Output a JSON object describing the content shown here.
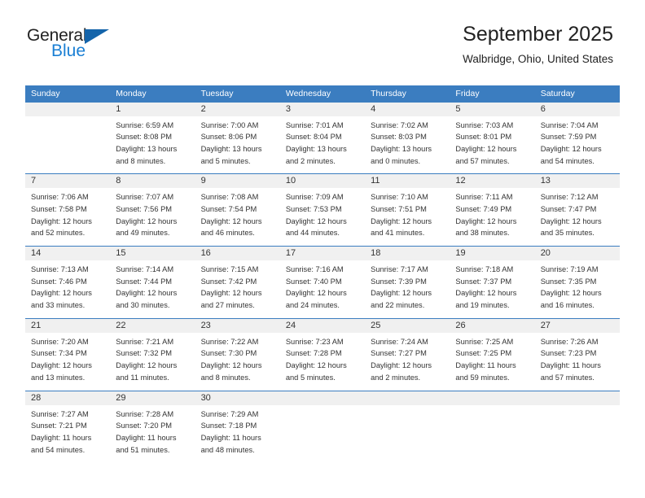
{
  "brand": {
    "name_top": "General",
    "name_bottom": "Blue",
    "accent_color": "#1a7fd4",
    "triangle_color": "#1464aa"
  },
  "header": {
    "title": "September 2025",
    "subtitle": "Walbridge, Ohio, United States"
  },
  "calendar": {
    "header_bg": "#3b7dc0",
    "daynum_bg": "#f0f0f0",
    "weekday_headers": [
      "Sunday",
      "Monday",
      "Tuesday",
      "Wednesday",
      "Thursday",
      "Friday",
      "Saturday"
    ],
    "weeks": [
      [
        {
          "day": "",
          "sunrise": "",
          "sunset": "",
          "daylight_1": "",
          "daylight_2": ""
        },
        {
          "day": "1",
          "sunrise": "Sunrise: 6:59 AM",
          "sunset": "Sunset: 8:08 PM",
          "daylight_1": "Daylight: 13 hours",
          "daylight_2": "and 8 minutes."
        },
        {
          "day": "2",
          "sunrise": "Sunrise: 7:00 AM",
          "sunset": "Sunset: 8:06 PM",
          "daylight_1": "Daylight: 13 hours",
          "daylight_2": "and 5 minutes."
        },
        {
          "day": "3",
          "sunrise": "Sunrise: 7:01 AM",
          "sunset": "Sunset: 8:04 PM",
          "daylight_1": "Daylight: 13 hours",
          "daylight_2": "and 2 minutes."
        },
        {
          "day": "4",
          "sunrise": "Sunrise: 7:02 AM",
          "sunset": "Sunset: 8:03 PM",
          "daylight_1": "Daylight: 13 hours",
          "daylight_2": "and 0 minutes."
        },
        {
          "day": "5",
          "sunrise": "Sunrise: 7:03 AM",
          "sunset": "Sunset: 8:01 PM",
          "daylight_1": "Daylight: 12 hours",
          "daylight_2": "and 57 minutes."
        },
        {
          "day": "6",
          "sunrise": "Sunrise: 7:04 AM",
          "sunset": "Sunset: 7:59 PM",
          "daylight_1": "Daylight: 12 hours",
          "daylight_2": "and 54 minutes."
        }
      ],
      [
        {
          "day": "7",
          "sunrise": "Sunrise: 7:06 AM",
          "sunset": "Sunset: 7:58 PM",
          "daylight_1": "Daylight: 12 hours",
          "daylight_2": "and 52 minutes."
        },
        {
          "day": "8",
          "sunrise": "Sunrise: 7:07 AM",
          "sunset": "Sunset: 7:56 PM",
          "daylight_1": "Daylight: 12 hours",
          "daylight_2": "and 49 minutes."
        },
        {
          "day": "9",
          "sunrise": "Sunrise: 7:08 AM",
          "sunset": "Sunset: 7:54 PM",
          "daylight_1": "Daylight: 12 hours",
          "daylight_2": "and 46 minutes."
        },
        {
          "day": "10",
          "sunrise": "Sunrise: 7:09 AM",
          "sunset": "Sunset: 7:53 PM",
          "daylight_1": "Daylight: 12 hours",
          "daylight_2": "and 44 minutes."
        },
        {
          "day": "11",
          "sunrise": "Sunrise: 7:10 AM",
          "sunset": "Sunset: 7:51 PM",
          "daylight_1": "Daylight: 12 hours",
          "daylight_2": "and 41 minutes."
        },
        {
          "day": "12",
          "sunrise": "Sunrise: 7:11 AM",
          "sunset": "Sunset: 7:49 PM",
          "daylight_1": "Daylight: 12 hours",
          "daylight_2": "and 38 minutes."
        },
        {
          "day": "13",
          "sunrise": "Sunrise: 7:12 AM",
          "sunset": "Sunset: 7:47 PM",
          "daylight_1": "Daylight: 12 hours",
          "daylight_2": "and 35 minutes."
        }
      ],
      [
        {
          "day": "14",
          "sunrise": "Sunrise: 7:13 AM",
          "sunset": "Sunset: 7:46 PM",
          "daylight_1": "Daylight: 12 hours",
          "daylight_2": "and 33 minutes."
        },
        {
          "day": "15",
          "sunrise": "Sunrise: 7:14 AM",
          "sunset": "Sunset: 7:44 PM",
          "daylight_1": "Daylight: 12 hours",
          "daylight_2": "and 30 minutes."
        },
        {
          "day": "16",
          "sunrise": "Sunrise: 7:15 AM",
          "sunset": "Sunset: 7:42 PM",
          "daylight_1": "Daylight: 12 hours",
          "daylight_2": "and 27 minutes."
        },
        {
          "day": "17",
          "sunrise": "Sunrise: 7:16 AM",
          "sunset": "Sunset: 7:40 PM",
          "daylight_1": "Daylight: 12 hours",
          "daylight_2": "and 24 minutes."
        },
        {
          "day": "18",
          "sunrise": "Sunrise: 7:17 AM",
          "sunset": "Sunset: 7:39 PM",
          "daylight_1": "Daylight: 12 hours",
          "daylight_2": "and 22 minutes."
        },
        {
          "day": "19",
          "sunrise": "Sunrise: 7:18 AM",
          "sunset": "Sunset: 7:37 PM",
          "daylight_1": "Daylight: 12 hours",
          "daylight_2": "and 19 minutes."
        },
        {
          "day": "20",
          "sunrise": "Sunrise: 7:19 AM",
          "sunset": "Sunset: 7:35 PM",
          "daylight_1": "Daylight: 12 hours",
          "daylight_2": "and 16 minutes."
        }
      ],
      [
        {
          "day": "21",
          "sunrise": "Sunrise: 7:20 AM",
          "sunset": "Sunset: 7:34 PM",
          "daylight_1": "Daylight: 12 hours",
          "daylight_2": "and 13 minutes."
        },
        {
          "day": "22",
          "sunrise": "Sunrise: 7:21 AM",
          "sunset": "Sunset: 7:32 PM",
          "daylight_1": "Daylight: 12 hours",
          "daylight_2": "and 11 minutes."
        },
        {
          "day": "23",
          "sunrise": "Sunrise: 7:22 AM",
          "sunset": "Sunset: 7:30 PM",
          "daylight_1": "Daylight: 12 hours",
          "daylight_2": "and 8 minutes."
        },
        {
          "day": "24",
          "sunrise": "Sunrise: 7:23 AM",
          "sunset": "Sunset: 7:28 PM",
          "daylight_1": "Daylight: 12 hours",
          "daylight_2": "and 5 minutes."
        },
        {
          "day": "25",
          "sunrise": "Sunrise: 7:24 AM",
          "sunset": "Sunset: 7:27 PM",
          "daylight_1": "Daylight: 12 hours",
          "daylight_2": "and 2 minutes."
        },
        {
          "day": "26",
          "sunrise": "Sunrise: 7:25 AM",
          "sunset": "Sunset: 7:25 PM",
          "daylight_1": "Daylight: 11 hours",
          "daylight_2": "and 59 minutes."
        },
        {
          "day": "27",
          "sunrise": "Sunrise: 7:26 AM",
          "sunset": "Sunset: 7:23 PM",
          "daylight_1": "Daylight: 11 hours",
          "daylight_2": "and 57 minutes."
        }
      ],
      [
        {
          "day": "28",
          "sunrise": "Sunrise: 7:27 AM",
          "sunset": "Sunset: 7:21 PM",
          "daylight_1": "Daylight: 11 hours",
          "daylight_2": "and 54 minutes."
        },
        {
          "day": "29",
          "sunrise": "Sunrise: 7:28 AM",
          "sunset": "Sunset: 7:20 PM",
          "daylight_1": "Daylight: 11 hours",
          "daylight_2": "and 51 minutes."
        },
        {
          "day": "30",
          "sunrise": "Sunrise: 7:29 AM",
          "sunset": "Sunset: 7:18 PM",
          "daylight_1": "Daylight: 11 hours",
          "daylight_2": "and 48 minutes."
        },
        {
          "day": "",
          "sunrise": "",
          "sunset": "",
          "daylight_1": "",
          "daylight_2": ""
        },
        {
          "day": "",
          "sunrise": "",
          "sunset": "",
          "daylight_1": "",
          "daylight_2": ""
        },
        {
          "day": "",
          "sunrise": "",
          "sunset": "",
          "daylight_1": "",
          "daylight_2": ""
        },
        {
          "day": "",
          "sunrise": "",
          "sunset": "",
          "daylight_1": "",
          "daylight_2": ""
        }
      ]
    ]
  }
}
